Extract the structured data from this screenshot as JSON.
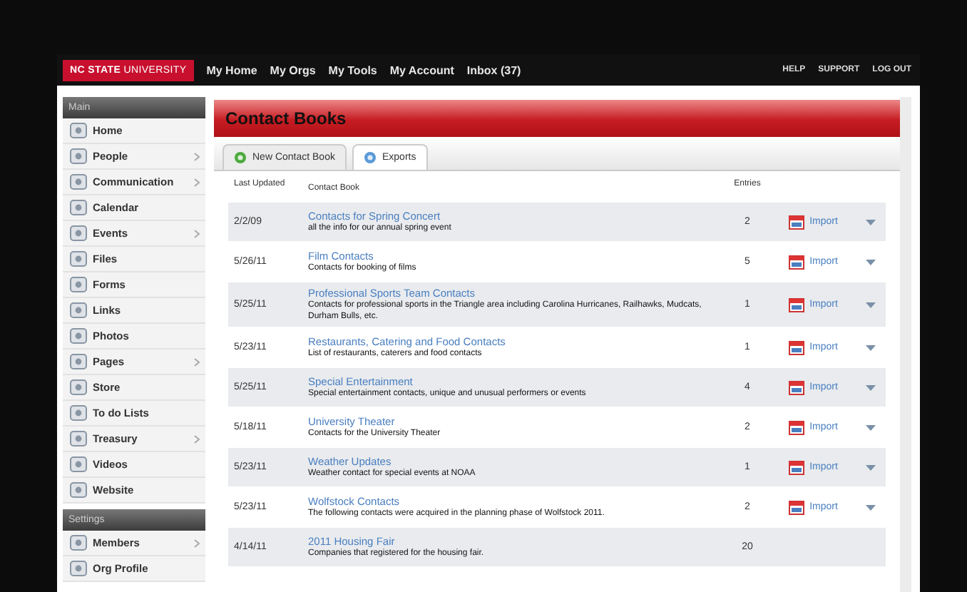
{
  "top_bar": {
    "logo": "**NC STATE** UNIVERSITY",
    "menu": [
      "My Home",
      "My Orgs",
      "My Tools",
      "My Account",
      "Inbox (37)"
    ],
    "links": [
      "HELP",
      "SUPPORT",
      "LOG OUT"
    ]
  },
  "sidebar": {
    "sections": [
      {
        "title": "Main",
        "items": [
          {
            "label": "Home",
            "submenu": false
          },
          {
            "label": "People",
            "submenu": true
          },
          {
            "label": "Communication",
            "submenu": true
          },
          {
            "label": "Calendar",
            "submenu": false
          },
          {
            "label": "Events",
            "submenu": true
          },
          {
            "label": "Files",
            "submenu": false
          },
          {
            "label": "Forms",
            "submenu": false
          },
          {
            "label": "Links",
            "submenu": false
          },
          {
            "label": "Photos",
            "submenu": false
          },
          {
            "label": "Pages",
            "submenu": true
          },
          {
            "label": "Store",
            "submenu": false
          },
          {
            "label": "To do Lists",
            "submenu": false
          },
          {
            "label": "Treasury",
            "submenu": true
          },
          {
            "label": "Videos",
            "submenu": false
          },
          {
            "label": "Website",
            "submenu": false
          }
        ]
      },
      {
        "title": "Settings",
        "items": [
          {
            "label": "Members",
            "submenu": true
          },
          {
            "label": "Org Profile",
            "submenu": false
          }
        ]
      }
    ]
  },
  "page_title": "Contact Books",
  "tabs": [
    {
      "label": "New Contact Book",
      "selected": false
    },
    {
      "label": "Exports",
      "selected": true
    }
  ],
  "table": {
    "columns": [
      "Last Updated",
      "Contact Book",
      "Entries"
    ],
    "rows": [
      {
        "date": "2/2/09",
        "title": "Contacts for Spring Concert",
        "description": "all the info for our annual spring event",
        "entries": "2",
        "action": "Import"
      },
      {
        "date": "5/26/11",
        "title": "Film Contacts",
        "description": "Contacts for booking of films",
        "entries": "5",
        "action": "Import"
      },
      {
        "date": "5/25/11",
        "title": "Professional Sports Team Contacts",
        "description": "Contacts for professional sports in the Triangle area including Carolina Hurricanes, Railhawks, Mudcats, Durham Bulls, etc.",
        "entries": "1",
        "action": "Import"
      },
      {
        "date": "5/23/11",
        "title": "Restaurants, Catering and Food Contacts",
        "description": "List of restaurants, caterers and food contacts",
        "entries": "1",
        "action": "Import"
      },
      {
        "date": "5/25/11",
        "title": "Special Entertainment",
        "description": "Special entertainment contacts, unique and unusual performers or events",
        "entries": "4",
        "action": "Import"
      },
      {
        "date": "5/18/11",
        "title": "University Theater",
        "description": "Contacts for the University Theater",
        "entries": "2",
        "action": "Import"
      },
      {
        "date": "5/23/11",
        "title": "Weather Updates",
        "description": "Weather contact for special events at NOAA",
        "entries": "1",
        "action": "Import"
      },
      {
        "date": "5/23/11",
        "title": "Wolfstock Contacts",
        "description": "The following contacts were acquired in the planning phase of Wolfstock 2011.",
        "entries": "2",
        "action": "Import"
      },
      {
        "date": "4/14/11",
        "title": "2011 Housing Fair",
        "description": "Companies that registered for the housing fair.",
        "entries": "20"
      }
    ]
  }
}
